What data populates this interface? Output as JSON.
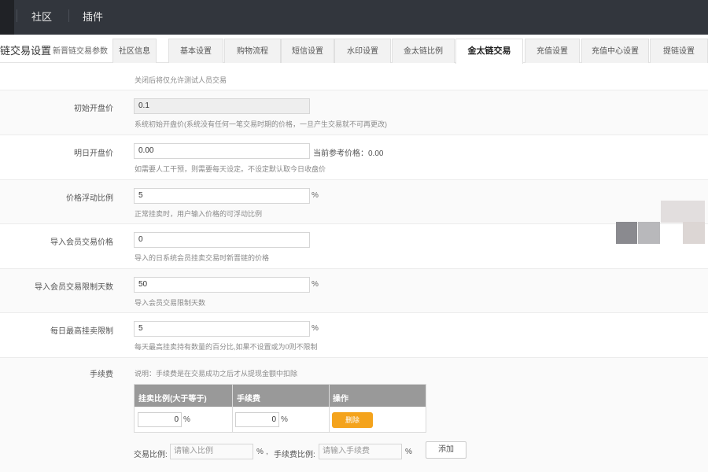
{
  "topnav": {
    "community": "社区",
    "plugins": "插件"
  },
  "header": {
    "title": "链交易设置",
    "subtitle": "新晋链交易参数"
  },
  "tabs": [
    "社区信息",
    "基本设置",
    "购物流程",
    "短信设置",
    "水印设置",
    "金太链比例",
    "金太链交易",
    "充值设置",
    "充值中心设置",
    "提链设置"
  ],
  "active_tab_index": 6,
  "form": {
    "top_hint": "关闭后将仅允许测试人员交易",
    "open_price": {
      "label": "初始开盘价",
      "value": "0.1",
      "hint": "系统初始开盘价(系统没有任何一笔交易时期的价格，一旦产生交易就不可再更改)"
    },
    "tomorrow_price": {
      "label": "明日开盘价",
      "value": "0.00",
      "ref": "当前参考价格：0.00",
      "hint": "如需要人工干预，则需要每天设定。不设定默认取今日收盘价"
    },
    "float_ratio": {
      "label": "价格浮动比例",
      "value": "5",
      "suffix": "%",
      "hint": "正常挂卖时，用户输入价格的可浮动比例"
    },
    "import_price": {
      "label": "导入会员交易价格",
      "value": "0",
      "hint": "导入的日系统会员挂卖交易时新晋链的价格"
    },
    "import_days": {
      "label": "导入会员交易限制天数",
      "value": "50",
      "suffix": "%",
      "hint": "导入会员交易限制天数"
    },
    "daily_limit": {
      "label": "每日最高挂卖限制",
      "value": "5",
      "suffix": "%",
      "hint": "每天最高挂卖持有数量的百分比,如果不设置或为0则不限制"
    },
    "fee": {
      "label": "手续费",
      "note": "说明：手续费是在交易成功之后才从提现金额中扣除",
      "col_ratio": "挂卖比例(大于等于)",
      "col_fee": "手续费",
      "col_action": "操作",
      "row": {
        "ratio": "0",
        "ratio_unit": "%",
        "fee": "0",
        "fee_unit": "%",
        "delete": "删除"
      },
      "add": {
        "trade_ratio_label": "交易比例:",
        "trade_ratio_placeholder": "请输入比例",
        "trade_ratio_unit": "%",
        "comma": ",",
        "fee_ratio_label": "手续费比例:",
        "fee_ratio_placeholder": "请输入手续费",
        "fee_ratio_unit": "%",
        "add_button": "添加"
      }
    }
  },
  "colors": {
    "topbar": "#32363d",
    "delete_button": "#f4a31c",
    "table_header": "#999999"
  }
}
